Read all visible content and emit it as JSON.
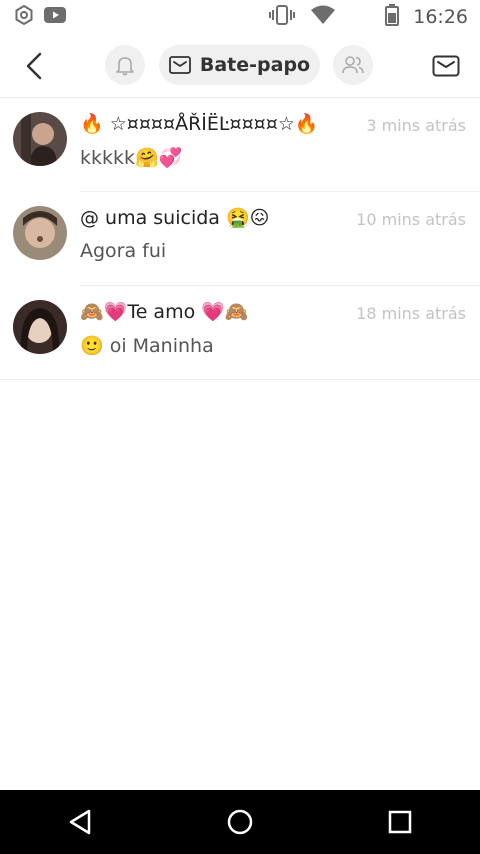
{
  "status_bar": {
    "time": "16:26",
    "icons": [
      "settings-gear-icon",
      "youtube-icon",
      "vibrate-icon",
      "wifi-icon",
      "battery-icon"
    ]
  },
  "header": {
    "back_icon": "chevron-left-icon",
    "notifications_icon": "bell-icon",
    "chat_tab": {
      "icon": "envelope-icon",
      "label": "Bate-papo"
    },
    "friends_icon": "people-icon",
    "compose_icon": "envelope-icon"
  },
  "chats": [
    {
      "name": "🔥 ☆¤¤¤¤ÅŘİËĿ¤¤¤¤☆🔥",
      "time": "3 mins atrás",
      "message": "kkkkk🤗💞",
      "avatar_color": "#5a4a45"
    },
    {
      "name": "@ uma suicida 🤮😖",
      "time": "10 mins atrás",
      "message": "Agora fui",
      "avatar_color": "#9a8a78"
    },
    {
      "name": "🙈💗Te amo 💗🙈",
      "time": "18 mins atrás",
      "message": "🙂 oi Maninha",
      "avatar_color": "#3a2a28"
    }
  ],
  "navigation_bar": {
    "back_icon": "triangle-back-icon",
    "home_icon": "circle-home-icon",
    "recents_icon": "square-recents-icon"
  }
}
